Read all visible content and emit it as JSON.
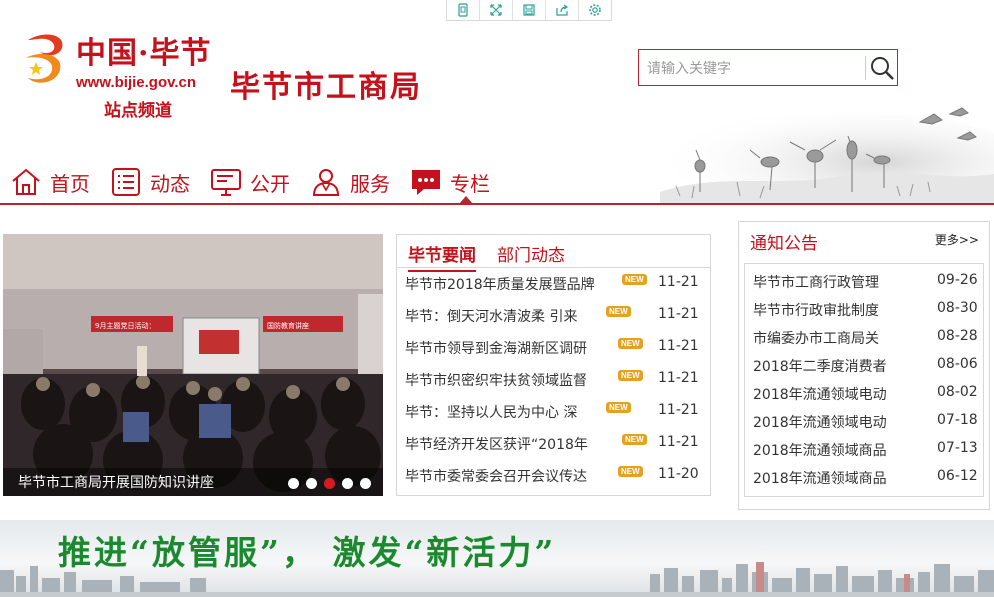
{
  "toolbar": {
    "icons": [
      "mobile-icon",
      "fullscreen-icon",
      "save-icon",
      "share-icon",
      "settings-icon"
    ]
  },
  "header": {
    "logo_text": "中国·毕节",
    "logo_url": "www.bijie.gov.cn",
    "logo_sub": "站点频道",
    "site_title": "毕节市工商局",
    "search_placeholder": "请输入关键字"
  },
  "nav": {
    "items": [
      {
        "label": "首页",
        "icon": "home-icon"
      },
      {
        "label": "动态",
        "icon": "list-icon"
      },
      {
        "label": "公开",
        "icon": "monitor-icon"
      },
      {
        "label": "服务",
        "icon": "people-icon"
      },
      {
        "label": "专栏",
        "icon": "chat-icon"
      }
    ],
    "active_index": 4
  },
  "slideshow": {
    "caption": "毕节市工商局开展国防知识讲座",
    "slide_count": 5,
    "active_dot": 2,
    "screen_banner_left": "9月主题党日活动：",
    "screen_banner_right": "国防教育讲座"
  },
  "news": {
    "tabs": [
      "毕节要闻",
      "部门动态"
    ],
    "active_tab": 0,
    "new_badge": "NEW",
    "items": [
      {
        "title": "毕节市2018年质量发展暨品牌",
        "date": "11-21"
      },
      {
        "title": "毕节：倒天河水清波柔 引来",
        "date": "11-21"
      },
      {
        "title": "毕节市领导到金海湖新区调研",
        "date": "11-21"
      },
      {
        "title": "毕节市织密织牢扶贫领域监督",
        "date": "11-21"
      },
      {
        "title": "毕节：坚持以人民为中心 深",
        "date": "11-21"
      },
      {
        "title": "毕节经济开发区获评“2018年",
        "date": "11-21"
      },
      {
        "title": "毕节市委常委会召开会议传达",
        "date": "11-20"
      }
    ]
  },
  "notice": {
    "title": "通知公告",
    "more": "更多>>",
    "items": [
      {
        "title": "毕节市工商行政管理",
        "date": "09-26"
      },
      {
        "title": "毕节市行政审批制度",
        "date": "08-30"
      },
      {
        "title": "市编委办市工商局关",
        "date": "08-28"
      },
      {
        "title": "2018年二季度消费者",
        "date": "08-06"
      },
      {
        "title": "2018年流通领域电动",
        "date": "08-02"
      },
      {
        "title": "2018年流通领域电动",
        "date": "07-18"
      },
      {
        "title": "2018年流通领域商品",
        "date": "07-13"
      },
      {
        "title": "2018年流通领域商品",
        "date": "06-12"
      }
    ]
  },
  "banner": {
    "text": "推进“放管服”， 激发“新活力”"
  },
  "colors": {
    "brand_red": "#c4111b",
    "banner_green": "#1b8a2f",
    "badge_orange": "#e8a020"
  }
}
